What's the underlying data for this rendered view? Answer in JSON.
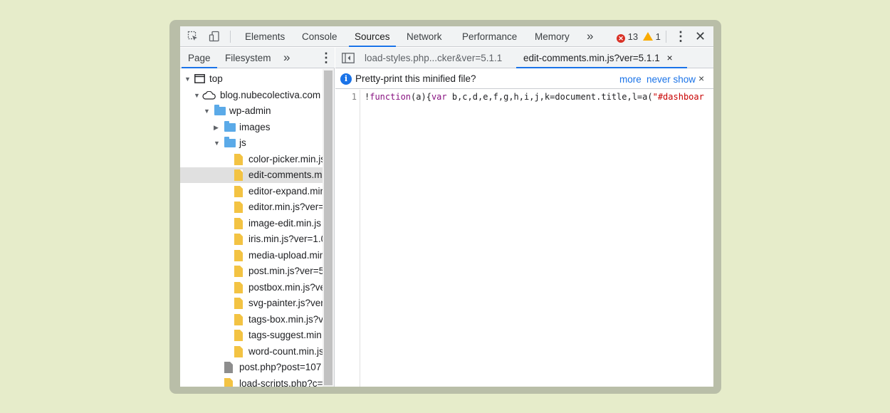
{
  "colors": {
    "background": "#e6ecca",
    "frame": "#b9bea8",
    "accent": "#1a73e8",
    "error": "#d93025",
    "warning": "#f9ab00",
    "folder": "#5baae8",
    "file": "#f3c343"
  },
  "toolbar": {
    "tabs": [
      "Elements",
      "Console",
      "Sources",
      "Network",
      "Performance",
      "Memory"
    ],
    "active_tab": "Sources",
    "more_tabs": "»",
    "error_count": "13",
    "warning_count": "1",
    "menu": "⋮",
    "close": "✕"
  },
  "navigator": {
    "tabs": [
      "Page",
      "Filesystem"
    ],
    "active_tab": "Page",
    "more": "»",
    "menu": "⋮"
  },
  "tree": {
    "top": "top",
    "domain": "blog.nubecolectiva.com",
    "wp_admin": "wp-admin",
    "images": "images",
    "js": "js",
    "js_files": [
      "color-picker.min.js",
      "edit-comments.min.js",
      "editor-expand.min.js",
      "editor.min.js?ver=",
      "image-edit.min.js",
      "iris.min.js?ver=1.0",
      "media-upload.min",
      "post.min.js?ver=5",
      "postbox.min.js?ver",
      "svg-painter.js?ver",
      "tags-box.min.js?v",
      "tags-suggest.min",
      "word-count.min.js"
    ],
    "selected_file": "edit-comments.min.js",
    "post_php": "post.php?post=107",
    "load_scripts": "load-scripts.php?c="
  },
  "editor": {
    "file_tabs": [
      "load-styles.php...cker&ver=5.1.1",
      "edit-comments.min.js?ver=5.1.1"
    ],
    "active_file_tab": "edit-comments.min.js?ver=5.1.1",
    "tab_close": "×",
    "infobar": {
      "text": "Pretty-print this minified file?",
      "more": "more",
      "never_show": "never show",
      "close": "×"
    },
    "line_number": "1",
    "code": {
      "bang": "!",
      "function_kw": "function",
      "sig": "(a){",
      "var_kw": "var",
      "decl": " b,c,d,e,f,g,h,i,j,k=document.title,l=a(",
      "selector": "\"#dashboar"
    }
  }
}
